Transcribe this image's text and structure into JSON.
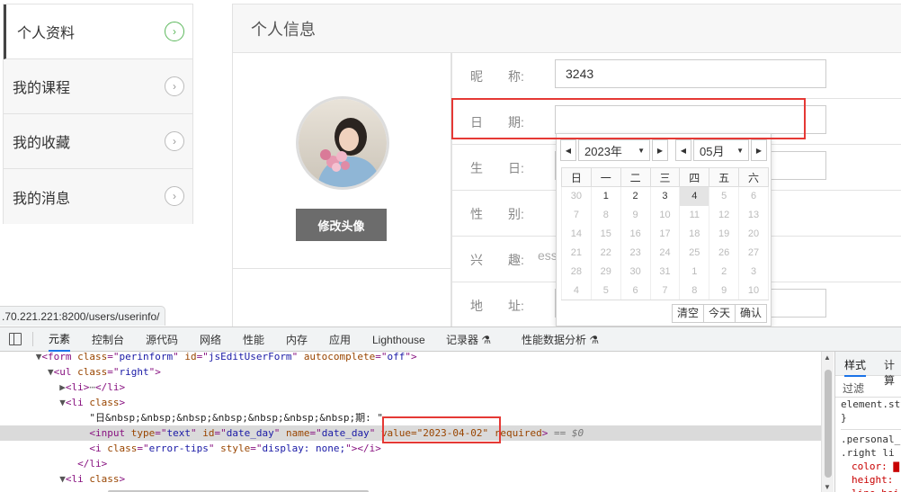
{
  "sidebar": {
    "items": [
      {
        "label": "个人资料",
        "active": true
      },
      {
        "label": "我的课程",
        "active": false
      },
      {
        "label": "我的收藏",
        "active": false
      },
      {
        "label": "我的消息",
        "active": false
      }
    ],
    "chevron": "›"
  },
  "panel": {
    "title": "个人信息",
    "avatar_button": "修改头像",
    "fields": [
      {
        "label": "昵　　称:",
        "value": "3243"
      },
      {
        "label": "日　　期:",
        "value": ""
      },
      {
        "label": "生　　日:",
        "value": ""
      },
      {
        "label": "性　　别:",
        "value": ""
      },
      {
        "label": "兴　　趣:",
        "value": ""
      },
      {
        "label": "地　　址:",
        "value": ""
      }
    ],
    "hidden_text": "ess"
  },
  "datepicker": {
    "year": "2023年",
    "month": "05月",
    "weekdays": [
      "日",
      "一",
      "二",
      "三",
      "四",
      "五",
      "六"
    ],
    "weeks": [
      [
        {
          "d": "30",
          "m": "prev"
        },
        {
          "d": "1",
          "m": "cur"
        },
        {
          "d": "2",
          "m": "cur"
        },
        {
          "d": "3",
          "m": "cur"
        },
        {
          "d": "4",
          "m": "today"
        },
        {
          "d": "5",
          "m": "next"
        },
        {
          "d": "6",
          "m": "next"
        }
      ],
      [
        {
          "d": "7",
          "m": "next"
        },
        {
          "d": "8",
          "m": "next"
        },
        {
          "d": "9",
          "m": "next"
        },
        {
          "d": "10",
          "m": "next"
        },
        {
          "d": "11",
          "m": "next"
        },
        {
          "d": "12",
          "m": "next"
        },
        {
          "d": "13",
          "m": "next"
        }
      ],
      [
        {
          "d": "14",
          "m": "next"
        },
        {
          "d": "15",
          "m": "next"
        },
        {
          "d": "16",
          "m": "next"
        },
        {
          "d": "17",
          "m": "next"
        },
        {
          "d": "18",
          "m": "next"
        },
        {
          "d": "19",
          "m": "next"
        },
        {
          "d": "20",
          "m": "next"
        }
      ],
      [
        {
          "d": "21",
          "m": "next"
        },
        {
          "d": "22",
          "m": "next"
        },
        {
          "d": "23",
          "m": "next"
        },
        {
          "d": "24",
          "m": "next"
        },
        {
          "d": "25",
          "m": "next"
        },
        {
          "d": "26",
          "m": "next"
        },
        {
          "d": "27",
          "m": "next"
        }
      ],
      [
        {
          "d": "28",
          "m": "next"
        },
        {
          "d": "29",
          "m": "next"
        },
        {
          "d": "30",
          "m": "next"
        },
        {
          "d": "31",
          "m": "next"
        },
        {
          "d": "1",
          "m": "next"
        },
        {
          "d": "2",
          "m": "next"
        },
        {
          "d": "3",
          "m": "next"
        }
      ],
      [
        {
          "d": "4",
          "m": "next"
        },
        {
          "d": "5",
          "m": "next"
        },
        {
          "d": "6",
          "m": "next"
        },
        {
          "d": "7",
          "m": "next"
        },
        {
          "d": "8",
          "m": "next"
        },
        {
          "d": "9",
          "m": "next"
        },
        {
          "d": "10",
          "m": "next"
        }
      ]
    ],
    "buttons": {
      "clear": "清空",
      "today": "今天",
      "confirm": "确认"
    }
  },
  "status_url": ".70.221.221:8200/users/userinfo/",
  "devtools": {
    "tabs": [
      "元素",
      "控制台",
      "源代码",
      "网络",
      "性能",
      "内存",
      "应用",
      "Lighthouse",
      "记录器 ⚗",
      "性能数据分析 ⚗"
    ],
    "active_tab": "元素",
    "styles_tabs": [
      "样式",
      "计算"
    ],
    "filter": "过滤",
    "style_lines": [
      ".personal_i",
      ".right li {",
      "color: ▇",
      "height:",
      "line-hei"
    ],
    "element_style": "element.sty",
    "element_style_close": "}",
    "dom": {
      "form_tag": "form",
      "form_attrs": [
        [
          "class",
          "perinform"
        ],
        [
          "id",
          "jsEditUserForm"
        ],
        [
          "autocomplete",
          "off"
        ]
      ],
      "ul_tag": "ul",
      "ul_class": "right",
      "li_collapsed": "<li>",
      "li_class": "class",
      "text_node": "\"日&nbsp;&nbsp;&nbsp;&nbsp;&nbsp;&nbsp;&nbsp;期: \"",
      "input_tag": "input",
      "input_attrs": [
        [
          "type",
          "text"
        ],
        [
          "id",
          "date_day"
        ],
        [
          "name",
          "date_day"
        ]
      ],
      "input_value": "value=\"2023-04-02\"",
      "input_required": "required",
      "input_suffix": "== $0",
      "i_tag": "i",
      "i_attrs": [
        [
          "class",
          "error-tips"
        ],
        [
          "style",
          "display: none;"
        ]
      ],
      "li_close": "</li>"
    }
  },
  "colors": {
    "highlight": "#e53935",
    "active_chevron": "#5cb85c",
    "button_gray": "#6c6c6c"
  }
}
